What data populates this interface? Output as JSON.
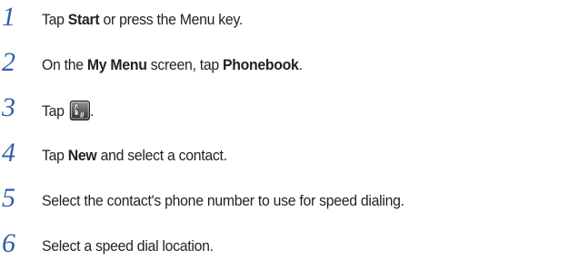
{
  "steps": [
    {
      "number": "1",
      "parts": [
        {
          "text": "Tap "
        },
        {
          "text": "Start",
          "bold": true
        },
        {
          "text": " or press the Menu key."
        }
      ]
    },
    {
      "number": "2",
      "parts": [
        {
          "text": "On the "
        },
        {
          "text": "My Menu",
          "bold": true
        },
        {
          "text": " screen, tap "
        },
        {
          "text": "Phonebook",
          "bold": true
        },
        {
          "text": "."
        }
      ]
    },
    {
      "number": "3",
      "parts": [
        {
          "text": "Tap "
        },
        {
          "icon": "speed-dial-icon"
        },
        {
          "text": "."
        }
      ]
    },
    {
      "number": "4",
      "parts": [
        {
          "text": "Tap "
        },
        {
          "text": "New",
          "bold": true
        },
        {
          "text": " and select a contact."
        }
      ]
    },
    {
      "number": "5",
      "parts": [
        {
          "text": "Select the contact's phone number to use for speed dialing."
        }
      ]
    },
    {
      "number": "6",
      "parts": [
        {
          "text": "Select a speed dial location."
        }
      ]
    }
  ],
  "colors": {
    "step_number": "#2f5fa8",
    "text": "#231f20"
  }
}
